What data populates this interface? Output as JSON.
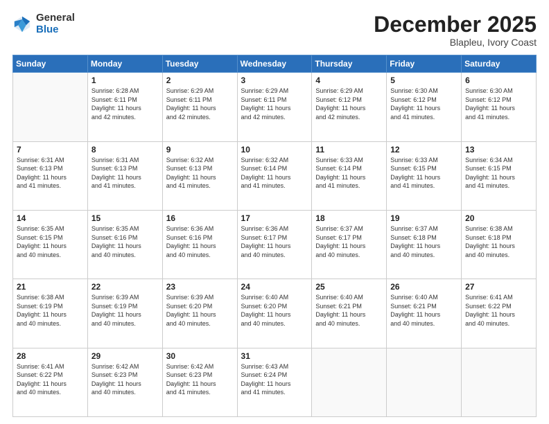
{
  "logo": {
    "general": "General",
    "blue": "Blue"
  },
  "header": {
    "month": "December 2025",
    "location": "Blapleu, Ivory Coast"
  },
  "weekdays": [
    "Sunday",
    "Monday",
    "Tuesday",
    "Wednesday",
    "Thursday",
    "Friday",
    "Saturday"
  ],
  "weeks": [
    [
      {
        "day": "",
        "info": ""
      },
      {
        "day": "1",
        "info": "Sunrise: 6:28 AM\nSunset: 6:11 PM\nDaylight: 11 hours\nand 42 minutes."
      },
      {
        "day": "2",
        "info": "Sunrise: 6:29 AM\nSunset: 6:11 PM\nDaylight: 11 hours\nand 42 minutes."
      },
      {
        "day": "3",
        "info": "Sunrise: 6:29 AM\nSunset: 6:11 PM\nDaylight: 11 hours\nand 42 minutes."
      },
      {
        "day": "4",
        "info": "Sunrise: 6:29 AM\nSunset: 6:12 PM\nDaylight: 11 hours\nand 42 minutes."
      },
      {
        "day": "5",
        "info": "Sunrise: 6:30 AM\nSunset: 6:12 PM\nDaylight: 11 hours\nand 41 minutes."
      },
      {
        "day": "6",
        "info": "Sunrise: 6:30 AM\nSunset: 6:12 PM\nDaylight: 11 hours\nand 41 minutes."
      }
    ],
    [
      {
        "day": "7",
        "info": "Sunrise: 6:31 AM\nSunset: 6:13 PM\nDaylight: 11 hours\nand 41 minutes."
      },
      {
        "day": "8",
        "info": "Sunrise: 6:31 AM\nSunset: 6:13 PM\nDaylight: 11 hours\nand 41 minutes."
      },
      {
        "day": "9",
        "info": "Sunrise: 6:32 AM\nSunset: 6:13 PM\nDaylight: 11 hours\nand 41 minutes."
      },
      {
        "day": "10",
        "info": "Sunrise: 6:32 AM\nSunset: 6:14 PM\nDaylight: 11 hours\nand 41 minutes."
      },
      {
        "day": "11",
        "info": "Sunrise: 6:33 AM\nSunset: 6:14 PM\nDaylight: 11 hours\nand 41 minutes."
      },
      {
        "day": "12",
        "info": "Sunrise: 6:33 AM\nSunset: 6:15 PM\nDaylight: 11 hours\nand 41 minutes."
      },
      {
        "day": "13",
        "info": "Sunrise: 6:34 AM\nSunset: 6:15 PM\nDaylight: 11 hours\nand 41 minutes."
      }
    ],
    [
      {
        "day": "14",
        "info": "Sunrise: 6:35 AM\nSunset: 6:15 PM\nDaylight: 11 hours\nand 40 minutes."
      },
      {
        "day": "15",
        "info": "Sunrise: 6:35 AM\nSunset: 6:16 PM\nDaylight: 11 hours\nand 40 minutes."
      },
      {
        "day": "16",
        "info": "Sunrise: 6:36 AM\nSunset: 6:16 PM\nDaylight: 11 hours\nand 40 minutes."
      },
      {
        "day": "17",
        "info": "Sunrise: 6:36 AM\nSunset: 6:17 PM\nDaylight: 11 hours\nand 40 minutes."
      },
      {
        "day": "18",
        "info": "Sunrise: 6:37 AM\nSunset: 6:17 PM\nDaylight: 11 hours\nand 40 minutes."
      },
      {
        "day": "19",
        "info": "Sunrise: 6:37 AM\nSunset: 6:18 PM\nDaylight: 11 hours\nand 40 minutes."
      },
      {
        "day": "20",
        "info": "Sunrise: 6:38 AM\nSunset: 6:18 PM\nDaylight: 11 hours\nand 40 minutes."
      }
    ],
    [
      {
        "day": "21",
        "info": "Sunrise: 6:38 AM\nSunset: 6:19 PM\nDaylight: 11 hours\nand 40 minutes."
      },
      {
        "day": "22",
        "info": "Sunrise: 6:39 AM\nSunset: 6:19 PM\nDaylight: 11 hours\nand 40 minutes."
      },
      {
        "day": "23",
        "info": "Sunrise: 6:39 AM\nSunset: 6:20 PM\nDaylight: 11 hours\nand 40 minutes."
      },
      {
        "day": "24",
        "info": "Sunrise: 6:40 AM\nSunset: 6:20 PM\nDaylight: 11 hours\nand 40 minutes."
      },
      {
        "day": "25",
        "info": "Sunrise: 6:40 AM\nSunset: 6:21 PM\nDaylight: 11 hours\nand 40 minutes."
      },
      {
        "day": "26",
        "info": "Sunrise: 6:40 AM\nSunset: 6:21 PM\nDaylight: 11 hours\nand 40 minutes."
      },
      {
        "day": "27",
        "info": "Sunrise: 6:41 AM\nSunset: 6:22 PM\nDaylight: 11 hours\nand 40 minutes."
      }
    ],
    [
      {
        "day": "28",
        "info": "Sunrise: 6:41 AM\nSunset: 6:22 PM\nDaylight: 11 hours\nand 40 minutes."
      },
      {
        "day": "29",
        "info": "Sunrise: 6:42 AM\nSunset: 6:23 PM\nDaylight: 11 hours\nand 40 minutes."
      },
      {
        "day": "30",
        "info": "Sunrise: 6:42 AM\nSunset: 6:23 PM\nDaylight: 11 hours\nand 41 minutes."
      },
      {
        "day": "31",
        "info": "Sunrise: 6:43 AM\nSunset: 6:24 PM\nDaylight: 11 hours\nand 41 minutes."
      },
      {
        "day": "",
        "info": ""
      },
      {
        "day": "",
        "info": ""
      },
      {
        "day": "",
        "info": ""
      }
    ]
  ]
}
